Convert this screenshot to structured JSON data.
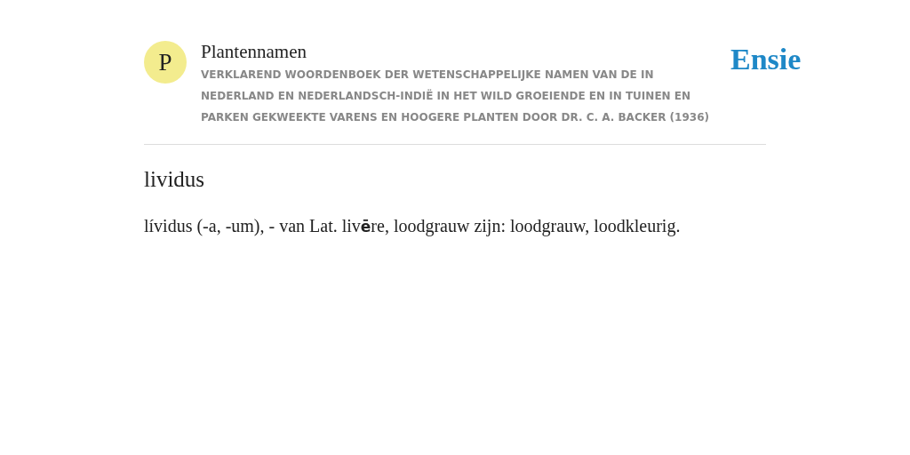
{
  "header": {
    "logo_letter": "P",
    "title": "Plantennamen",
    "subtitle": "VERKLAREND WOORDENBOEK DER WETENSCHAPPELIJKE NAMEN VAN DE IN NEDERLAND EN NEDERLANDSCH-INDIË IN HET WILD GROEIENDE EN IN TUINEN EN PARKEN GEKWEEKTE VARENS EN HOOGERE PLANTEN DOOR DR. C. A. BACKER (1936)",
    "brand": "Ensie"
  },
  "entry": {
    "term": "lividus",
    "definition": "lívidus (-a, -um), - van Lat. liv**ē**re, loodgrauw zijn: loodgrauw, loodkleurig."
  }
}
